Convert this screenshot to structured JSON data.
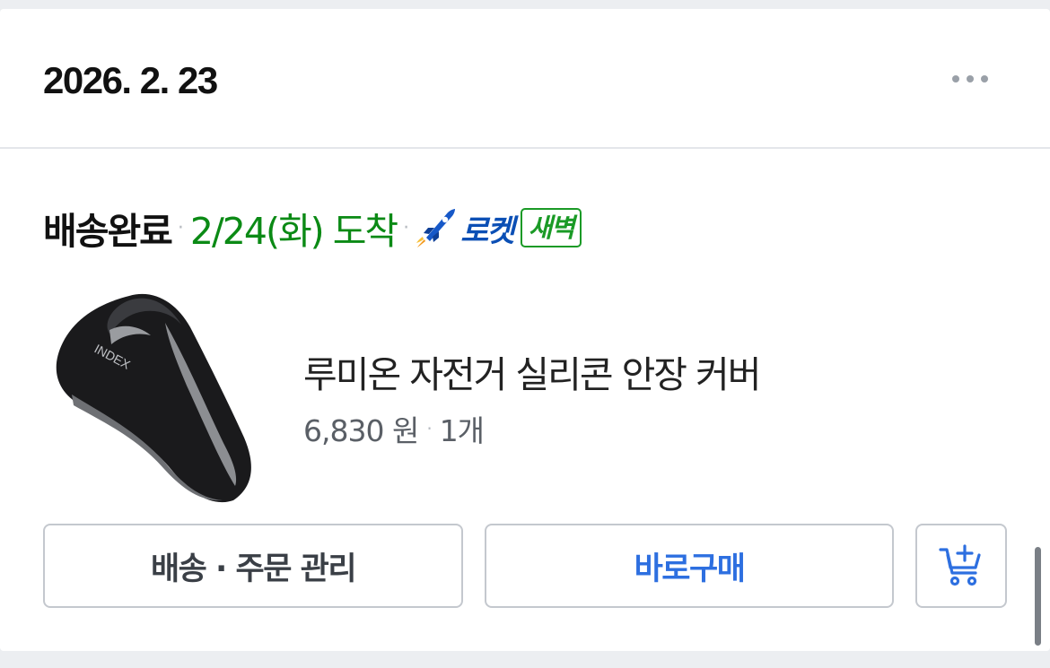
{
  "order": {
    "date": "2026. 2. 23",
    "more_label": "더보기"
  },
  "shipment": {
    "status": "배송완료",
    "separator": "·",
    "arrival": "2/24(화) 도착",
    "rocket_label": "로켓",
    "rocket_badge": "새벽"
  },
  "product": {
    "name": "루미온 자전거 실리콘 안장 커버",
    "price": "6,830 원",
    "separator": "·",
    "quantity": "1개",
    "thumbnail_icon": "bicycle-saddle-image"
  },
  "actions": {
    "manage_label": "배송 · 주문 관리",
    "buy_label": "바로구매",
    "cart_icon": "add-to-cart-icon"
  },
  "colors": {
    "arrival_green": "#0b8a15",
    "rocket_blue": "#0b4fb5",
    "buy_blue": "#2d6fe0"
  }
}
